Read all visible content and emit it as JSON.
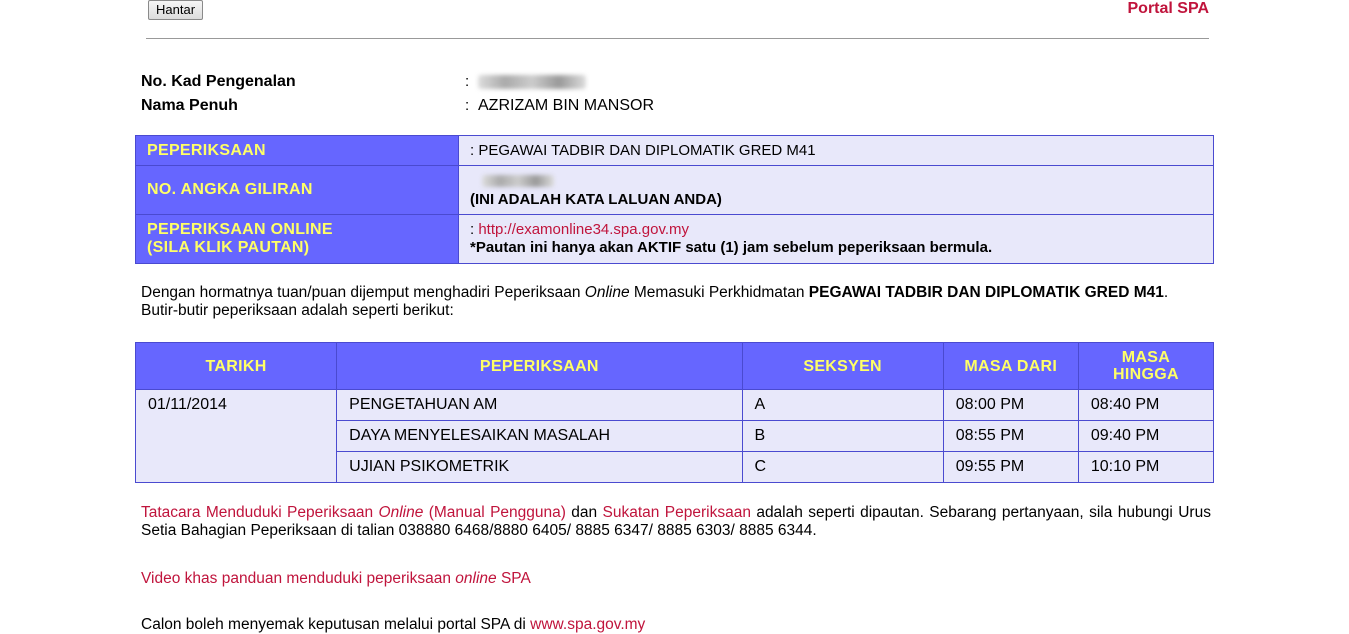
{
  "header": {
    "submit_label": "Hantar",
    "portal_label": "Portal SPA"
  },
  "identity": {
    "ic_label": "No. Kad Pengenalan",
    "ic_colon": ":",
    "name_label": "Nama Penuh",
    "name_colon": ":",
    "name_value": "AZRIZAM BIN MANSOR"
  },
  "info": {
    "exam_label": "PEPERIKSAAN",
    "exam_value": ": PEGAWAI TADBIR DAN DIPLOMATIK GRED M41",
    "turn_label": "NO. ANGKA GILIRAN",
    "turn_note": "(INI ADALAH KATA LALUAN ANDA)",
    "online_label_1": "PEPERIKSAAN ONLINE",
    "online_label_2": "(SILA KLIK PAUTAN)",
    "online_colon": ":",
    "online_link": "http://examonline34.spa.gov.my",
    "online_note": "*Pautan ini hanya akan AKTIF satu (1) jam sebelum peperiksaan bermula."
  },
  "intro": {
    "part1": "Dengan hormatnya tuan/puan dijemput menghadiri Peperiksaan ",
    "italic": "Online",
    "part2": " Memasuki Perkhidmatan ",
    "bold": "PEGAWAI TADBIR DAN DIPLOMATIK GRED M41",
    "part3": ".",
    "line2": "Butir-butir peperiksaan adalah seperti berikut:"
  },
  "schedule": {
    "headers": [
      "TARIKH",
      "PEPERIKSAAN",
      "SEKSYEN",
      "MASA DARI",
      "MASA HINGGA"
    ],
    "date": "01/11/2014",
    "rows": [
      {
        "exam": "PENGETAHUAN AM",
        "section": "A",
        "from": "08:00 PM",
        "to": "08:40 PM"
      },
      {
        "exam": "DAYA MENYELESAIKAN MASALAH",
        "section": "B",
        "from": "08:55 PM",
        "to": "09:40 PM"
      },
      {
        "exam": "UJIAN PSIKOMETRIK",
        "section": "C",
        "from": "09:55 PM",
        "to": "10:10 PM"
      }
    ]
  },
  "note": {
    "link1_a": "Tatacara Menduduki Peperiksaan ",
    "link1_italic": "Online",
    "link1_b": " (Manual Pengguna)",
    "and": " dan ",
    "link2": "Sukatan Peperiksaan",
    "rest": " adalah seperti dipautan. Sebarang pertanyaan, sila hubungi Urus Setia Bahagian Peperiksaan di talian 038880 6468/8880 6405/ 8885 6347/ 8885 6303/ 8885 6344."
  },
  "video": {
    "part1": "Video khas panduan menduduki peperiksaan ",
    "italic": "online",
    "part2": " SPA"
  },
  "footer_cut": {
    "text": "Calon boleh menyemak keputusan melalui portal SPA di ",
    "link": "www.spa.gov.my"
  }
}
